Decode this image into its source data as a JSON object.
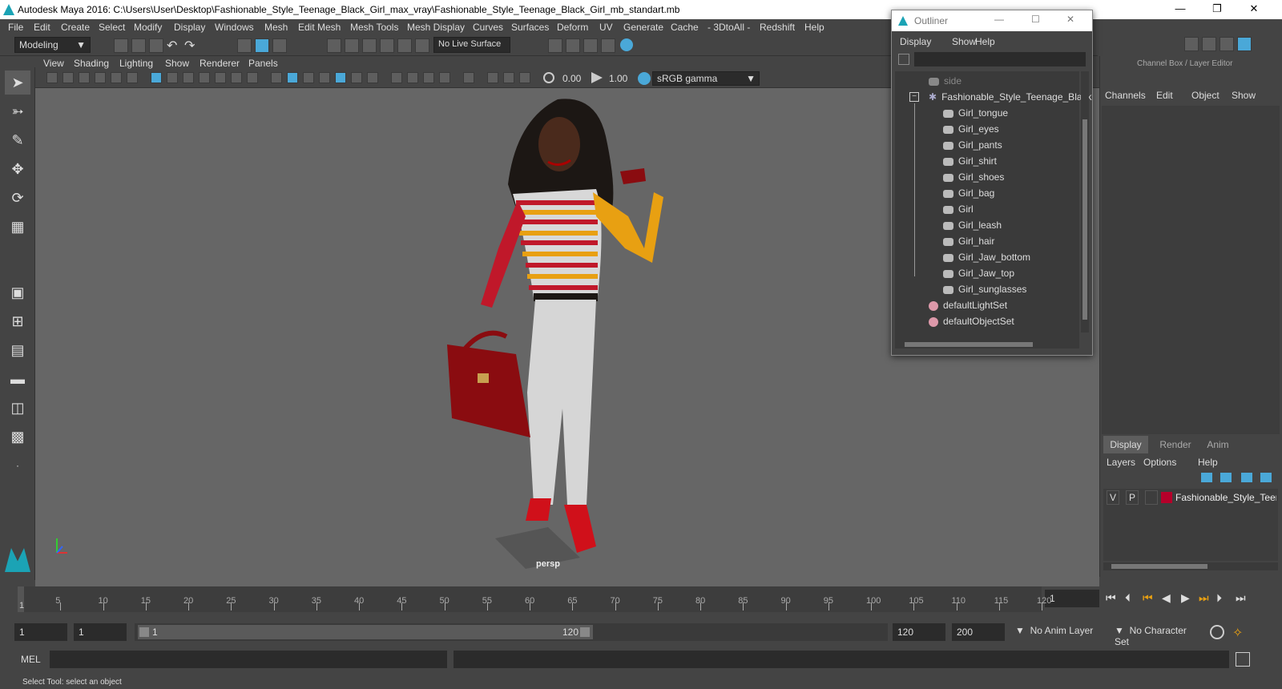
{
  "window": {
    "title": "Autodesk Maya 2016: C:\\Users\\User\\Desktop\\Fashionable_Style_Teenage_Black_Girl_max_vray\\Fashionable_Style_Teenage_Black_Girl_mb_standart.mb"
  },
  "menubar": [
    "File",
    "Edit",
    "Create",
    "Select",
    "Modify",
    "Display",
    "Windows",
    "Mesh",
    "Edit Mesh",
    "Mesh Tools",
    "Mesh Display",
    "Curves",
    "Surfaces",
    "Deform",
    "UV",
    "Generate",
    "Cache",
    "- 3DtoAll -",
    "Redshift",
    "Help"
  ],
  "shelf": {
    "mode": "Modeling",
    "live_surface": "No Live Surface"
  },
  "viewport_menu": [
    "View",
    "Shading",
    "Lighting",
    "Show",
    "Renderer",
    "Panels"
  ],
  "viewport_tools": {
    "exposure": "0.00",
    "gamma": "1.00",
    "color_space": "sRGB gamma"
  },
  "viewport": {
    "camera_label": "persp"
  },
  "outliner": {
    "title": "Outliner",
    "menu": [
      "Display",
      "Show",
      "Help"
    ],
    "items": [
      "side",
      "Fashionable_Style_Teenage_Black",
      "Girl_tongue",
      "Girl_eyes",
      "Girl_pants",
      "Girl_shirt",
      "Girl_shoes",
      "Girl_bag",
      "Girl",
      "Girl_leash",
      "Girl_hair",
      "Girl_Jaw_bottom",
      "Girl_Jaw_top",
      "Girl_sunglasses",
      "defaultLightSet",
      "defaultObjectSet"
    ]
  },
  "channel_box": {
    "title": "Channel Box / Layer Editor",
    "menu": [
      "Channels",
      "Edit",
      "Object",
      "Show"
    ],
    "tabs": [
      "Display",
      "Render",
      "Anim"
    ],
    "layer_menu": [
      "Layers",
      "Options",
      "Help"
    ],
    "layer": {
      "v": "V",
      "p": "P",
      "name": "Fashionable_Style_Teena",
      "color": "#b5002a"
    }
  },
  "timeline": {
    "ticks": [
      "5",
      "10",
      "15",
      "20",
      "25",
      "30",
      "35",
      "40",
      "45",
      "50",
      "55",
      "60",
      "65",
      "70",
      "75",
      "80",
      "85",
      "90",
      "95",
      "100",
      "105",
      "110",
      "115",
      "120"
    ],
    "start": "1",
    "current_frame": "1"
  },
  "range": {
    "start": "1",
    "anim_start": "1",
    "slider_start": "1",
    "slider_end": "120",
    "end": "120",
    "anim_end": "200",
    "anim_layer": "No Anim Layer",
    "character_set": "No Character Set"
  },
  "mel": {
    "label": "MEL"
  },
  "help_line": "Select Tool: select an object",
  "colors": {
    "accent": "#4aa8d8",
    "viewport_bg": "#666666",
    "selected_tab": "#5d5d5d"
  }
}
